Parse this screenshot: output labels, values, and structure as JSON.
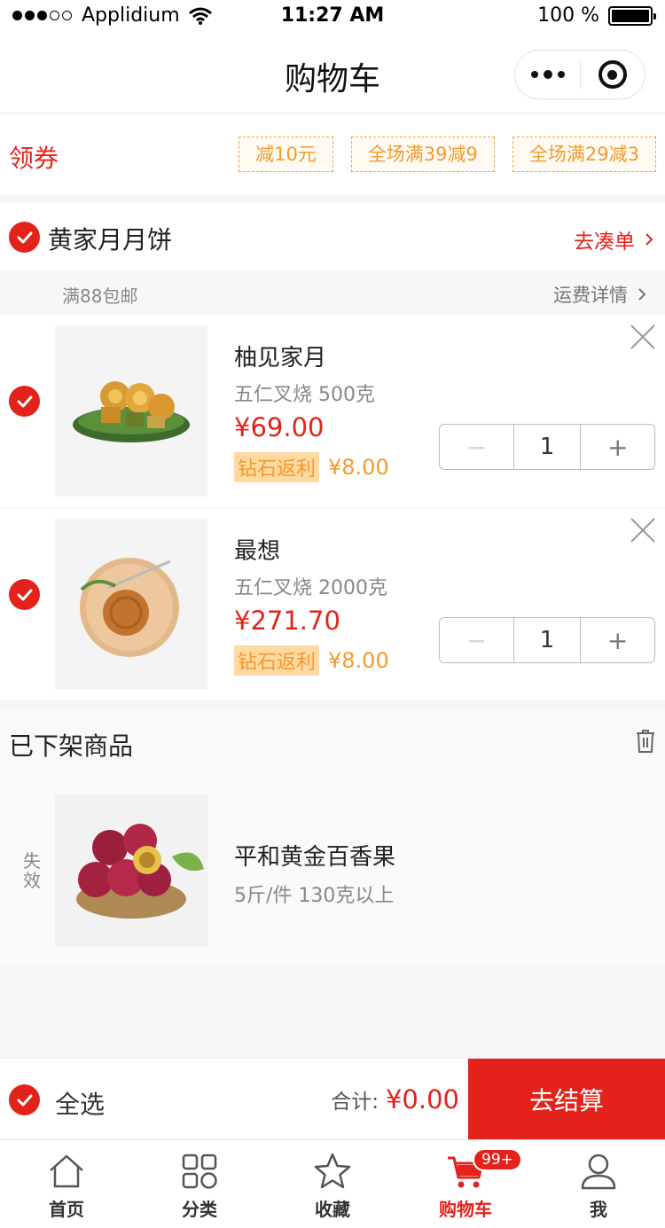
{
  "status_bar": {
    "carrier": "Applidium",
    "time": "11:27 AM",
    "battery": "100 %",
    "signal_bars": 3,
    "signal_total": 5
  },
  "nav": {
    "title": "购物车"
  },
  "coupon": {
    "label": "领券",
    "tags": [
      "减10元",
      "全场满39减9",
      "全场满29减3"
    ]
  },
  "shop": {
    "name": "黄家月月饼",
    "link": "去凑单",
    "shipping_note": "满88包邮",
    "shipping_link": "运费详情"
  },
  "items": [
    {
      "name": "柚见家月",
      "spec": "五仁叉烧 500克",
      "price": "¥69.00",
      "rebate_label": "钻石返利",
      "rebate_amount": "¥8.00",
      "quantity": "1",
      "minus": "−",
      "plus": "+"
    },
    {
      "name": "最想",
      "spec": "五仁叉烧 2000克",
      "price": "¥271.70",
      "rebate_label": "钻石返利",
      "rebate_amount": "¥8.00",
      "quantity": "1",
      "minus": "−",
      "plus": "+"
    }
  ],
  "invalid": {
    "title": "已下架商品",
    "label": "失效",
    "item": {
      "name": "平和黄金百香果",
      "spec": "5斤/件 130克以上"
    }
  },
  "checkout": {
    "select_all": "全选",
    "total_label": "合计:",
    "total_amount": "¥0.00",
    "button": "去结算"
  },
  "tabbar": {
    "tabs": [
      {
        "label": "首页",
        "icon": "home-icon"
      },
      {
        "label": "分类",
        "icon": "category-icon"
      },
      {
        "label": "收藏",
        "icon": "star-icon"
      },
      {
        "label": "购物车",
        "icon": "cart-icon",
        "badge": "99+",
        "active": true
      },
      {
        "label": "我",
        "icon": "user-icon"
      }
    ]
  },
  "colors": {
    "accent": "#e3231b",
    "rebate": "#f39a2b"
  }
}
